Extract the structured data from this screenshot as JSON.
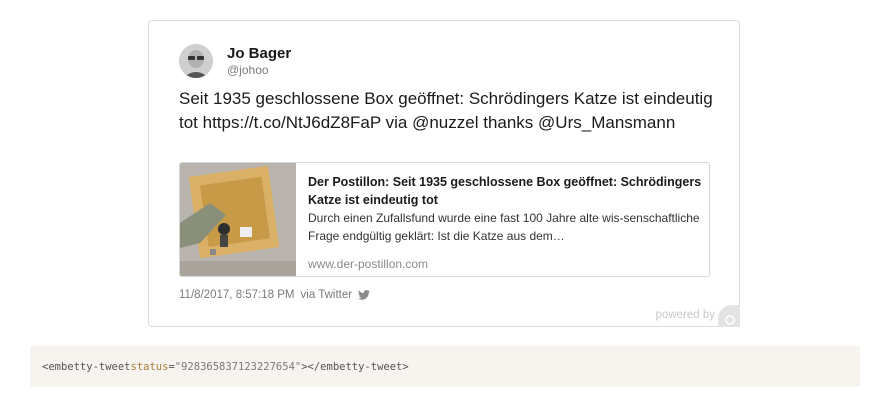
{
  "tweet": {
    "author_name": "Jo Bager",
    "author_handle": "@johoo",
    "text_parts": {
      "main": "Seit 1935 geschlossene Box geöffnet: Schrödingers Katze ist eindeutig tot ",
      "url": "https://t.co/NtJ6dZ8FaP",
      "via": " via ",
      "mention1": "@nuzzel",
      "thanks": " thanks ",
      "mention2": "@Urs_Mansmann"
    },
    "link_card": {
      "title": "Der Postillon: Seit 1935 geschlossene Box geöffnet: Schrödingers Katze ist eindeutig tot",
      "description": "Durch einen Zufallsfund wurde eine fast 100 Jahre alte wis-senschaftliche Frage endgültig geklärt: Ist die Katze aus dem…",
      "domain": "www.der-postillon.com"
    },
    "timestamp": "11/8/2017, 8:57:18 PM",
    "source": "via Twitter",
    "icons": {
      "twitter": "twitter-bird-icon",
      "embetty": "embetty-logo-icon"
    }
  },
  "footer": {
    "powered_by": "powered by"
  },
  "code": {
    "open_tag": "<embetty-tweet ",
    "attr_name": "status",
    "equals": "=",
    "attr_value": "\"928365837123227654\"",
    "close": "></embetty-tweet>"
  },
  "colors": {
    "text": "#1a1a1a",
    "muted": "#7a7a7a",
    "code_bg": "#f7f3ee",
    "code_attr": "#a8803a"
  }
}
